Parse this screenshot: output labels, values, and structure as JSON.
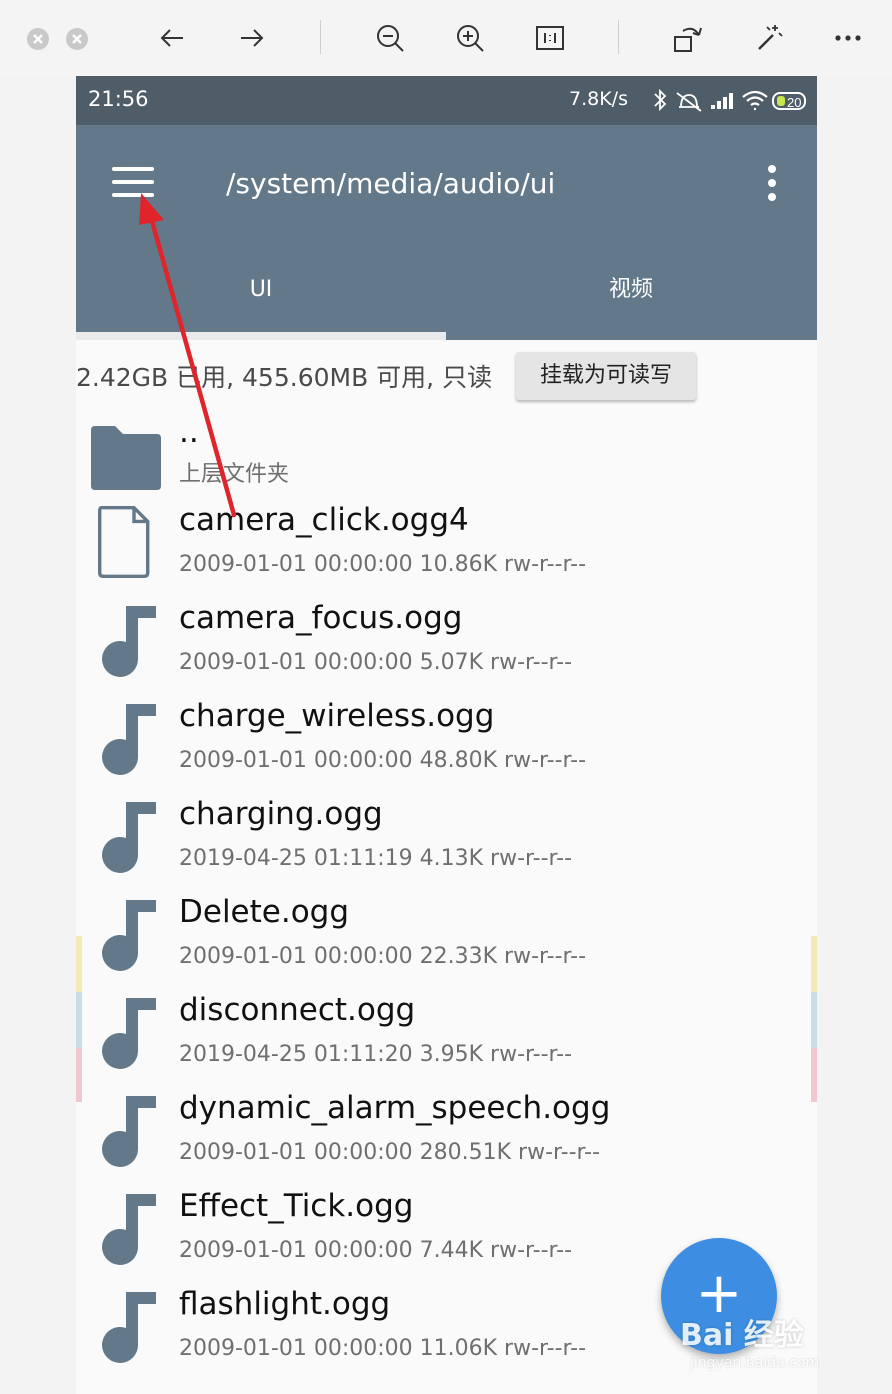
{
  "viewer": {
    "buttons": [
      "close-icon",
      "minimize-icon",
      "back-arrow-icon",
      "forward-arrow-icon",
      "zoom-out-icon",
      "zoom-in-icon",
      "actual-size-icon",
      "rotate-icon",
      "magic-wand-icon",
      "more-icon"
    ]
  },
  "statusbar": {
    "time": "21:56",
    "speed": "7.8K/s",
    "battery": "20"
  },
  "appbar": {
    "path": "/system/media/audio/ui"
  },
  "tabs": [
    {
      "label": "UI"
    },
    {
      "label": "视频"
    }
  ],
  "storage": {
    "info": "2.42GB 已用, 455.60MB 可用, 只读",
    "mount_button": "挂载为可读写"
  },
  "files": [
    {
      "name": "..",
      "meta": "上层文件夹",
      "icon": "folder-icon"
    },
    {
      "name": "camera_click.ogg4",
      "meta": "2009-01-01 00:00:00  10.86K  rw-r--r--",
      "icon": "file-icon"
    },
    {
      "name": "camera_focus.ogg",
      "meta": "2009-01-01 00:00:00  5.07K  rw-r--r--",
      "icon": "music-note-icon"
    },
    {
      "name": "charge_wireless.ogg",
      "meta": "2009-01-01 00:00:00  48.80K  rw-r--r--",
      "icon": "music-note-icon"
    },
    {
      "name": "charging.ogg",
      "meta": "2019-04-25 01:11:19  4.13K  rw-r--r--",
      "icon": "music-note-icon"
    },
    {
      "name": "Delete.ogg",
      "meta": "2009-01-01 00:00:00  22.33K  rw-r--r--",
      "icon": "music-note-icon"
    },
    {
      "name": "disconnect.ogg",
      "meta": "2019-04-25 01:11:20  3.95K  rw-r--r--",
      "icon": "music-note-icon"
    },
    {
      "name": "dynamic_alarm_speech.ogg",
      "meta": "2009-01-01 00:00:00  280.51K  rw-r--r--",
      "icon": "music-note-icon"
    },
    {
      "name": "Effect_Tick.ogg",
      "meta": "2009-01-01 00:00:00  7.44K  rw-r--r--",
      "icon": "music-note-icon"
    },
    {
      "name": "flashlight.ogg",
      "meta": "2009-01-01 00:00:00  11.06K  rw-r--r--",
      "icon": "music-note-icon"
    }
  ],
  "fab": {
    "label": "+"
  },
  "watermark": {
    "brand": "Bai 经验",
    "url": "jingyan.baidu.com"
  },
  "colors": {
    "appbar": "#63798a",
    "statusbar": "#4f5d69",
    "icon": "#63798a",
    "fab": "#3d8ee2",
    "annotation_arrow": "#e0242b"
  }
}
